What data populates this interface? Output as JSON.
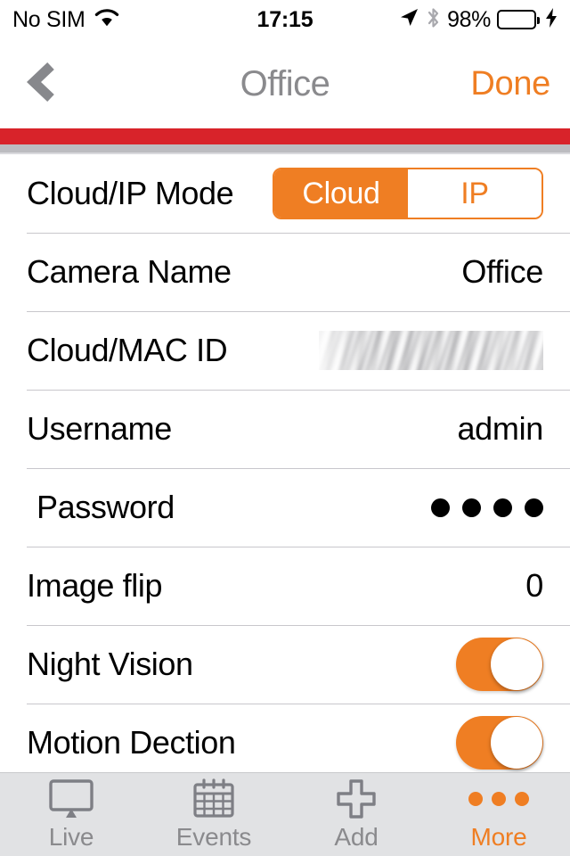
{
  "status_bar": {
    "carrier": "No SIM",
    "wifi_icon": "wifi-icon",
    "time": "17:15",
    "location_icon": "location-arrow-icon",
    "bluetooth_icon": "bluetooth-icon",
    "battery_percent": "98%",
    "battery_level": 98,
    "battery_color": "#4ccd5e",
    "charging_icon": "lightning-bolt-icon"
  },
  "nav_bar": {
    "back_icon": "chevron-left-icon",
    "title": "Office",
    "done_label": "Done"
  },
  "theme": {
    "accent": "#ef7e23",
    "divider_red": "#d8232a",
    "divider_gray": "#bcbcc0",
    "title_gray": "#8a8a8d"
  },
  "settings_rows": [
    {
      "label": "Cloud/IP Mode",
      "type": "segmented",
      "options": [
        "Cloud",
        "IP"
      ],
      "selected": "Cloud"
    },
    {
      "label": "Camera Name",
      "type": "value",
      "value": "Office"
    },
    {
      "label": "Cloud/MAC ID",
      "type": "redacted",
      "value": ""
    },
    {
      "label": "Username",
      "type": "value",
      "value": "admin"
    },
    {
      "label": "Password",
      "type": "password",
      "dots": 4
    },
    {
      "label": "Image flip",
      "type": "value",
      "value": "0"
    },
    {
      "label": "Night Vision",
      "type": "toggle",
      "on": true
    },
    {
      "label": "Motion Dection",
      "type": "toggle",
      "on": true
    }
  ],
  "tab_bar": {
    "tabs": [
      {
        "label": "Live",
        "icon": "monitor-icon",
        "active": false
      },
      {
        "label": "Events",
        "icon": "calendar-icon",
        "active": false
      },
      {
        "label": "Add",
        "icon": "plus-icon",
        "active": false
      },
      {
        "label": "More",
        "icon": "ellipsis-icon",
        "active": true
      }
    ]
  }
}
